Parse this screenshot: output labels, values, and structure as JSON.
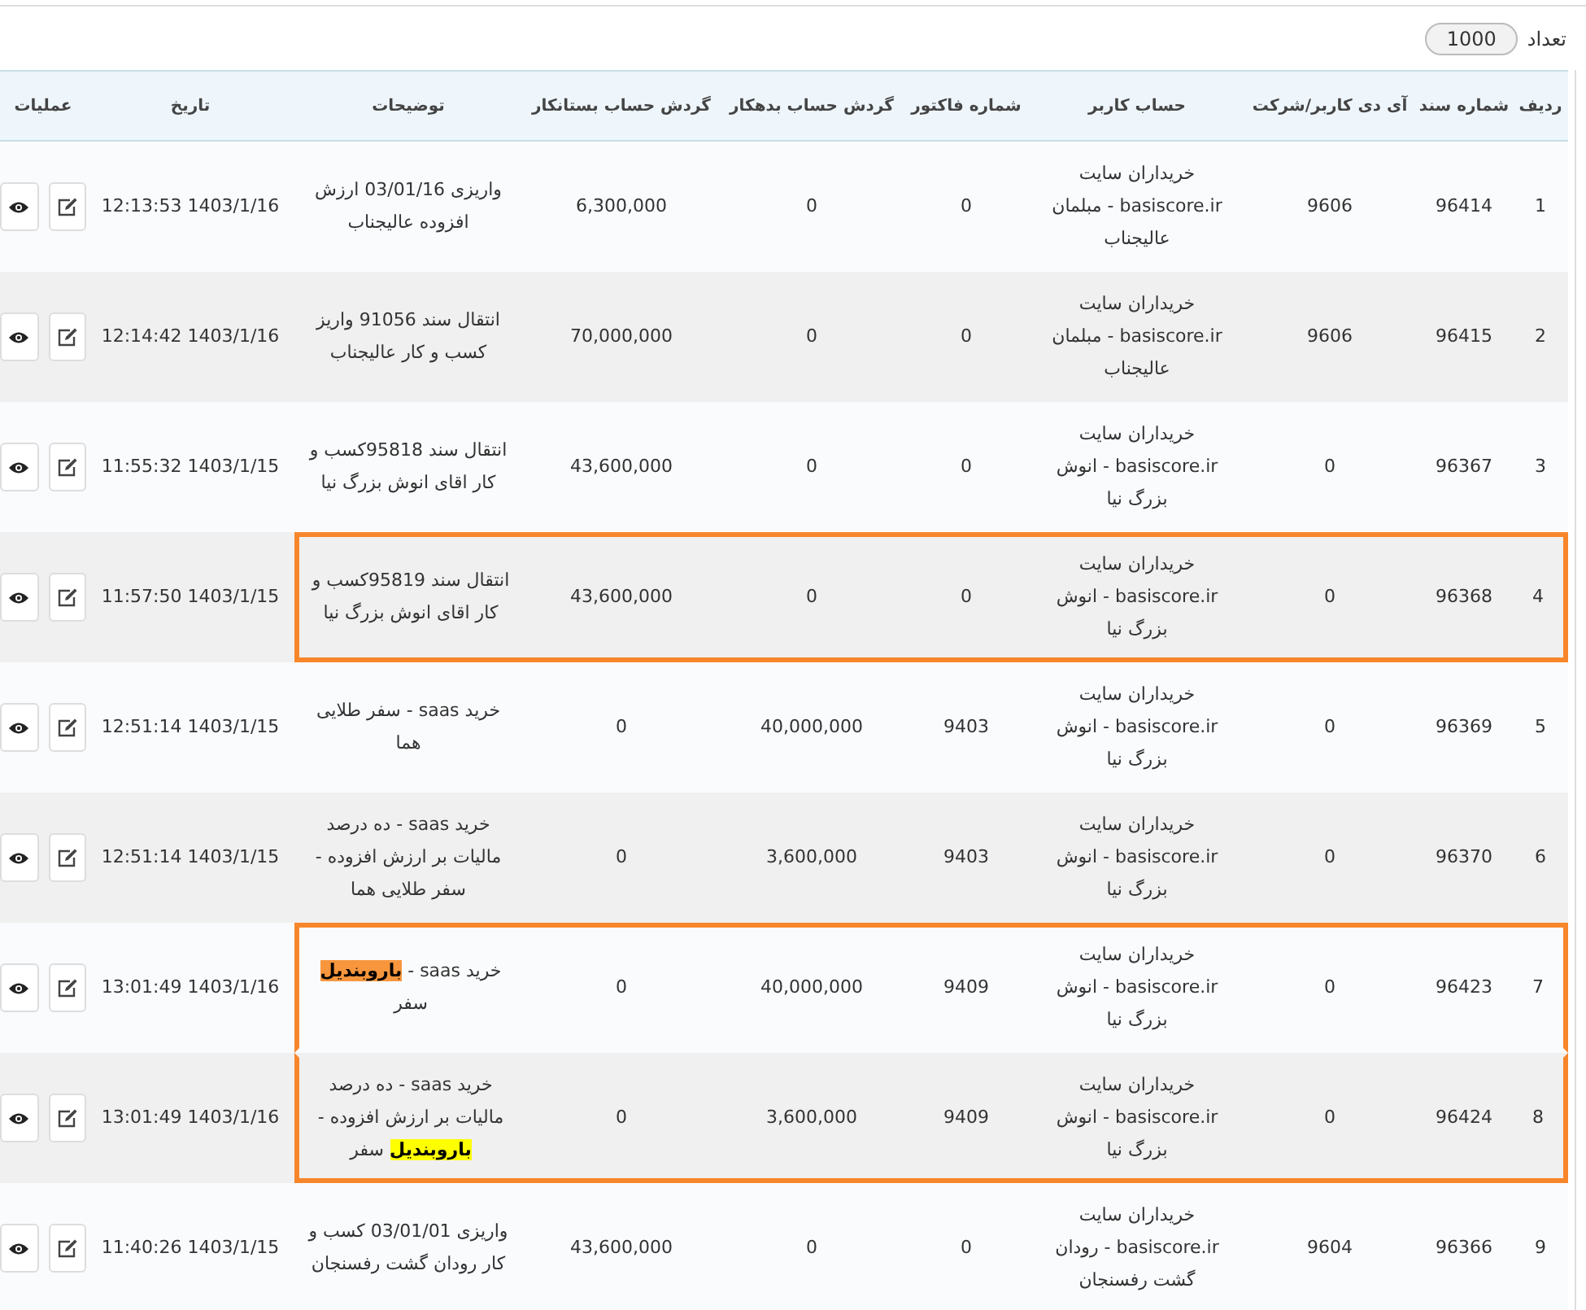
{
  "count": {
    "label": "تعداد",
    "value": "1000"
  },
  "table": {
    "columns": [
      "ردیف",
      "شماره سند",
      "آی دی کاربر/شرکت",
      "حساب کاربر",
      "شماره فاکتور",
      "گردش حساب بدهکار",
      "گردش حساب بستانکار",
      "توضیحات",
      "تاریخ",
      "عملیات"
    ],
    "rows": [
      {
        "row": "1",
        "doc": "96414",
        "user_id": "9606",
        "account": "خریداران سایت basiscore.ir - مبلمان عالیجناب",
        "invoice": "0",
        "debit": "0",
        "credit": "6,300,000",
        "description": [
          {
            "text": "واریزی 03/01/16 ارزش افزوده عالیجناب"
          }
        ],
        "date": "12:13:53 1403/1/16",
        "outlined": false
      },
      {
        "row": "2",
        "doc": "96415",
        "user_id": "9606",
        "account": "خریداران سایت basiscore.ir - مبلمان عالیجناب",
        "invoice": "0",
        "debit": "0",
        "credit": "70,000,000",
        "description": [
          {
            "text": "انتقال سند 91056 واریز کسب و کار عالیجناب"
          }
        ],
        "date": "12:14:42 1403/1/16",
        "outlined": false
      },
      {
        "row": "3",
        "doc": "96367",
        "user_id": "0",
        "account": "خریداران سایت basiscore.ir - انوش بزرگ نیا",
        "invoice": "0",
        "debit": "0",
        "credit": "43,600,000",
        "description": [
          {
            "text": "انتقال سند 95818کسب و کار اقای انوش بزرگ نیا"
          }
        ],
        "date": "11:55:32 1403/1/15",
        "outlined": false
      },
      {
        "row": "4",
        "doc": "96368",
        "user_id": "0",
        "account": "خریداران سایت basiscore.ir - انوش بزرگ نیا",
        "invoice": "0",
        "debit": "0",
        "credit": "43,600,000",
        "description": [
          {
            "text": "انتقال سند 95819کسب و کار اقای انوش بزرگ نیا"
          }
        ],
        "date": "11:57:50 1403/1/15",
        "outlined": true
      },
      {
        "row": "5",
        "doc": "96369",
        "user_id": "0",
        "account": "خریداران سایت basiscore.ir - انوش بزرگ نیا",
        "invoice": "9403",
        "debit": "40,000,000",
        "credit": "0",
        "description": [
          {
            "text": "خرید saas - سفر طلایی هما"
          }
        ],
        "date": "12:51:14 1403/1/15",
        "outlined": false
      },
      {
        "row": "6",
        "doc": "96370",
        "user_id": "0",
        "account": "خریداران سایت basiscore.ir - انوش بزرگ نیا",
        "invoice": "9403",
        "debit": "3,600,000",
        "credit": "0",
        "description": [
          {
            "text": "خرید saas - ده درصد مالیات بر ارزش افزوده - سفر طلایی هما"
          }
        ],
        "date": "12:51:14 1403/1/15",
        "outlined": false
      },
      {
        "row": "7",
        "doc": "96423",
        "user_id": "0",
        "account": "خریداران سایت basiscore.ir - انوش بزرگ نیا",
        "invoice": "9409",
        "debit": "40,000,000",
        "credit": "0",
        "description": [
          {
            "text": "خرید saas - "
          },
          {
            "text": "باروبندیل",
            "color": "#f7963d"
          },
          {
            "text": " سفر"
          }
        ],
        "date": "13:01:49 1403/1/16",
        "outlined": true
      },
      {
        "row": "8",
        "doc": "96424",
        "user_id": "0",
        "account": "خریداران سایت basiscore.ir - انوش بزرگ نیا",
        "invoice": "9409",
        "debit": "3,600,000",
        "credit": "0",
        "description": [
          {
            "text": "خرید saas - ده درصد مالیات بر ارزش افزوده - "
          },
          {
            "text": "باروبندیل",
            "color": "#ffff00"
          },
          {
            "text": " سفر"
          }
        ],
        "date": "13:01:49 1403/1/16",
        "outlined": true
      },
      {
        "row": "9",
        "doc": "96366",
        "user_id": "9604",
        "account": "خریداران سایت basiscore.ir - رودان گشت رفسنجان",
        "invoice": "0",
        "debit": "0",
        "credit": "43,600,000",
        "description": [
          {
            "text": "واریزی 03/01/01 کسب و کار رودان گشت رفسنجان"
          }
        ],
        "date": "11:40:26 1403/1/15",
        "outlined": false
      }
    ]
  }
}
